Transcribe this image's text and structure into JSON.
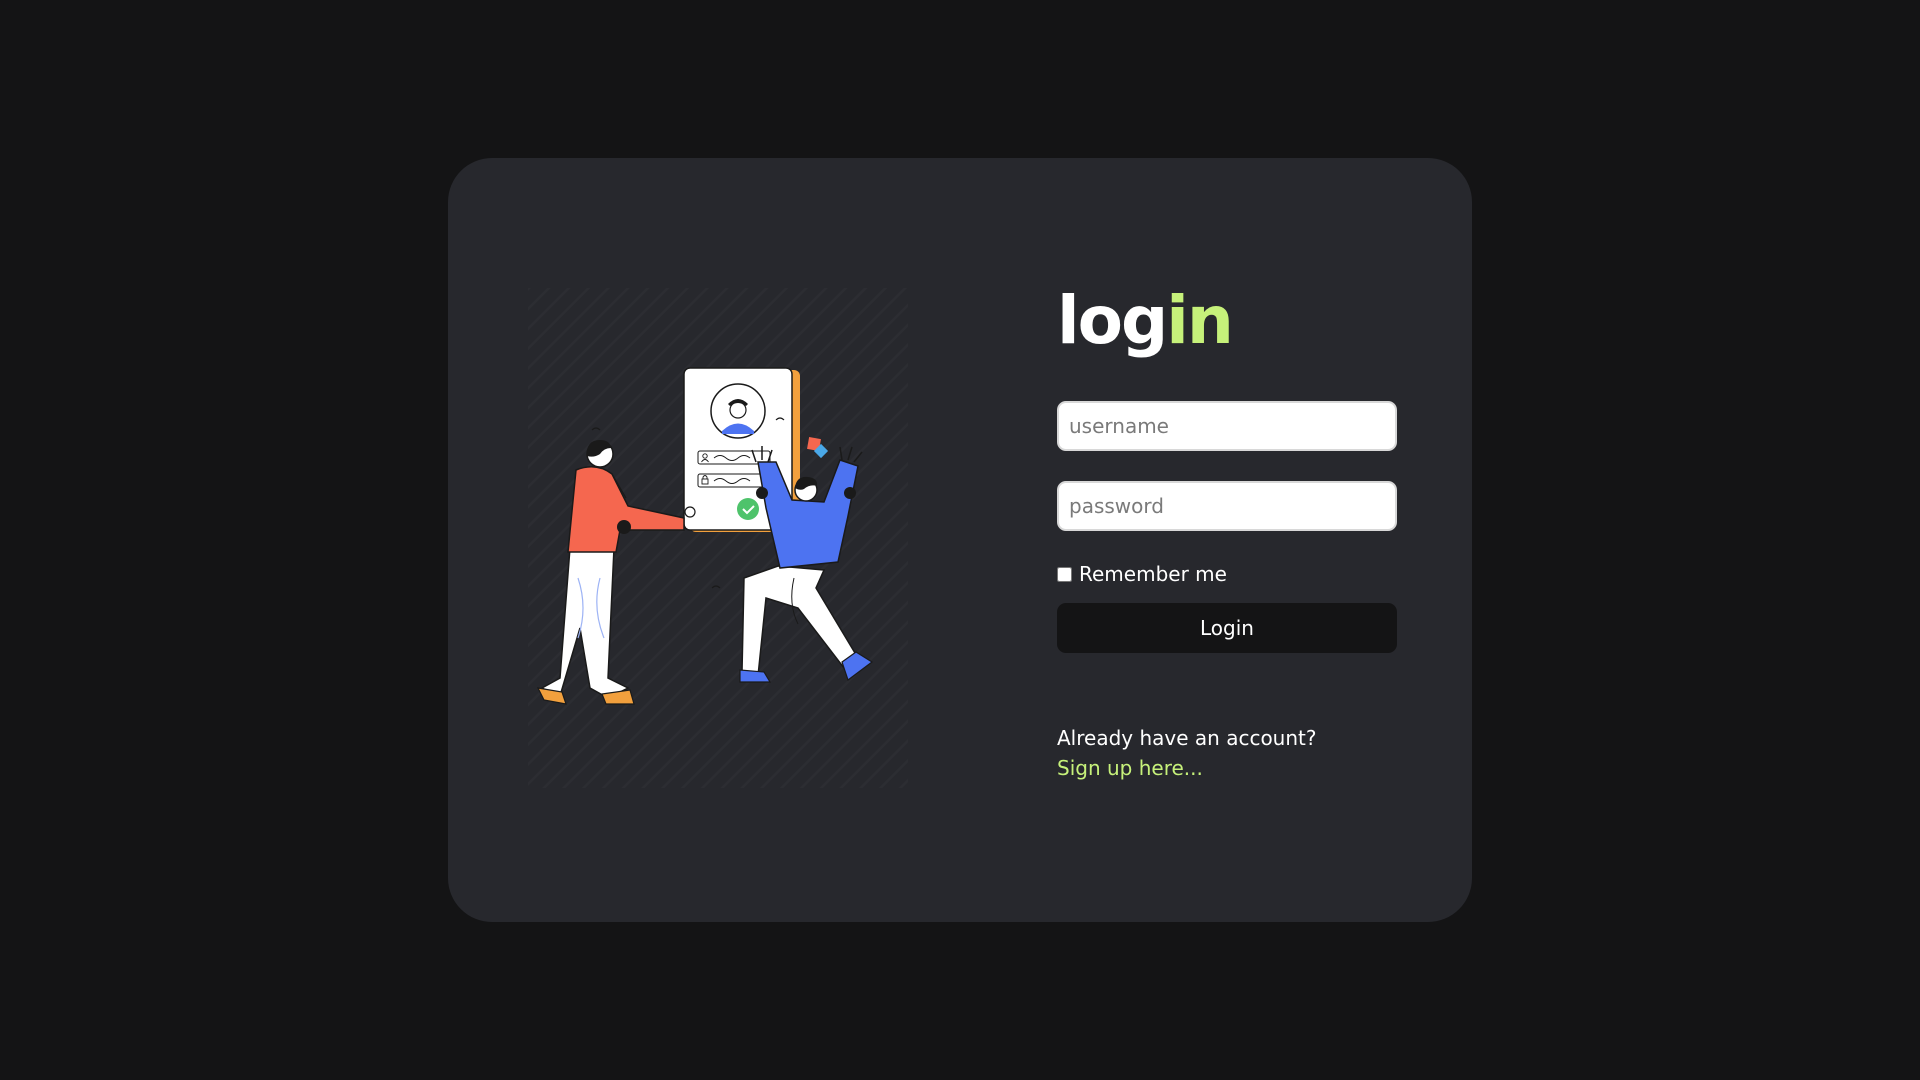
{
  "login": {
    "title_main": "log",
    "title_accent": "in",
    "username_placeholder": "username",
    "username_value": "",
    "password_placeholder": "password",
    "password_value": "",
    "remember_label": "Remember me",
    "remember_checked": false,
    "login_button_label": "Login",
    "signup_question": "Already have an account?",
    "signup_link_label": "Sign up here..."
  },
  "colors": {
    "page_background": "#141415",
    "card_background": "#27282d",
    "accent": "#c6f17a",
    "button_background": "#141415",
    "illustration_red": "#f5674f",
    "illustration_blue": "#4d73f1",
    "illustration_orange": "#f2a03d",
    "illustration_green": "#4ec36b"
  },
  "icons": {
    "illustration": "two-people-login-illustration",
    "profile": "profile-avatar-icon",
    "user": "user-icon",
    "lock": "lock-icon",
    "check": "check-icon"
  }
}
